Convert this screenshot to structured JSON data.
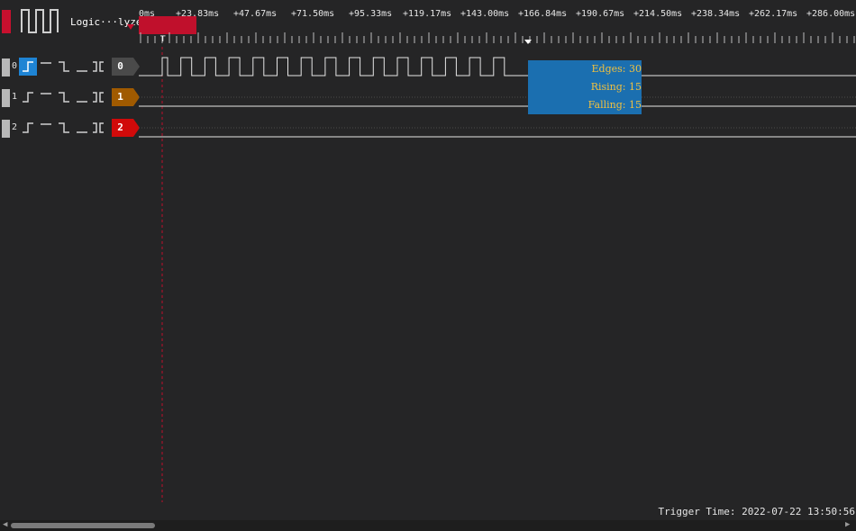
{
  "app": {
    "title": "Logic···lyzer",
    "accent_color": "#c8102e"
  },
  "timeline": {
    "labels": [
      "0ms",
      "+23.83ms",
      "+47.67ms",
      "+71.50ms",
      "+95.33ms",
      "+119.17ms",
      "+143.00ms",
      "+166.84ms",
      "+190.67ms",
      "+214.50ms",
      "+238.34ms",
      "+262.17ms",
      "+286.00ms"
    ],
    "trigger_marker_label": "T"
  },
  "channels": [
    {
      "index": "0",
      "tag": "0",
      "tag_color": "#4a4a4a",
      "active_trigger": "rising-edge"
    },
    {
      "index": "1",
      "tag": "1",
      "tag_color": "#a05a00",
      "active_trigger": "none"
    },
    {
      "index": "2",
      "tag": "2",
      "tag_color": "#d10a0a",
      "active_trigger": "none"
    }
  ],
  "measurement": {
    "edges": "Edges: 30",
    "rising": "Rising: 15",
    "falling": "Falling: 15",
    "highlight_color": "#1b6fb0",
    "text_color": "#f0c040"
  },
  "status": {
    "trigger_time": "Trigger Time: 2022-07-22 13:50:56"
  }
}
